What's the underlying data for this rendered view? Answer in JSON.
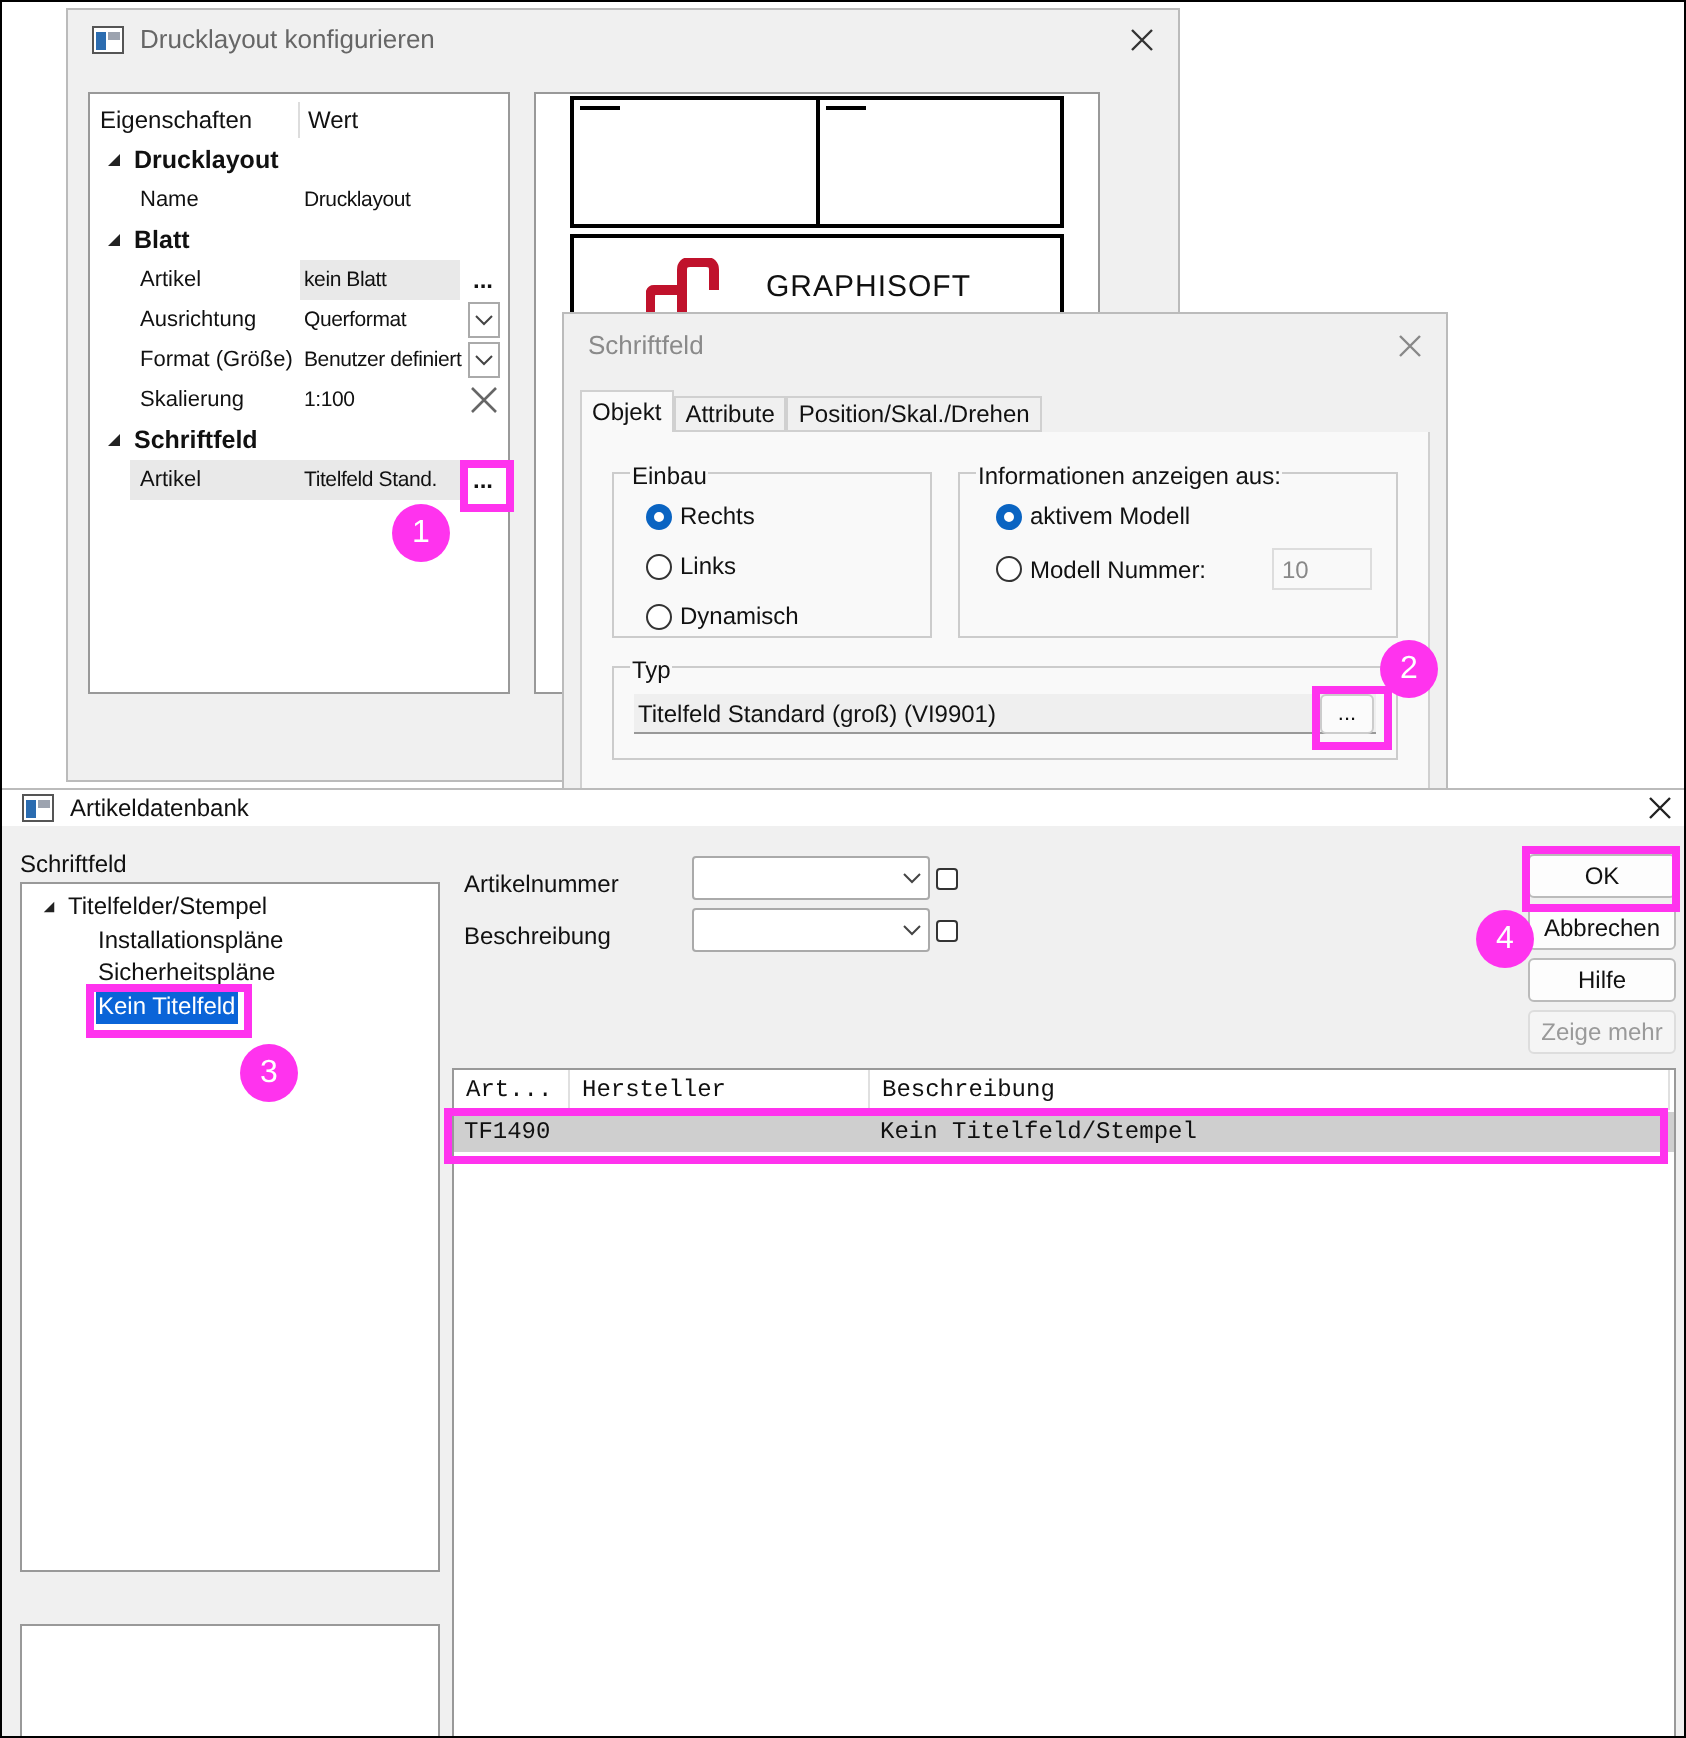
{
  "drucklayout": {
    "title": "Drucklayout konfigurieren",
    "columns": [
      "Eigenschaften",
      "Wert"
    ],
    "groups": [
      {
        "label": "Drucklayout",
        "expanded": true,
        "rows": [
          {
            "name": "Name",
            "value": "Drucklayout",
            "kind": "text",
            "selected": false
          }
        ]
      },
      {
        "label": "Blatt",
        "expanded": true,
        "rows": [
          {
            "name": "Artikel",
            "value": "kein Blatt",
            "kind": "ellipsis",
            "selected": false
          },
          {
            "name": "Ausrichtung",
            "value": "Querformat",
            "kind": "dropdown",
            "selected": false
          },
          {
            "name": "Format (Größe)",
            "value": "Benutzer definiert",
            "kind": "dropdown",
            "selected": false
          },
          {
            "name": "Skalierung",
            "value": "1:100",
            "kind": "clear",
            "selected": false
          }
        ]
      },
      {
        "label": "Schriftfeld",
        "expanded": true,
        "rows": [
          {
            "name": "Artikel",
            "value": "Titelfeld Stand.",
            "kind": "button",
            "selected": true
          }
        ]
      }
    ],
    "row_button": "...",
    "preview": {
      "logo_text": "GRAPHISOFT"
    }
  },
  "schriftfeld": {
    "title": "Schriftfeld",
    "tabs": [
      {
        "label": "Objekt",
        "selected": true
      },
      {
        "label": "Attribute",
        "selected": false
      },
      {
        "label": "Position/Skal./Drehen",
        "selected": false
      }
    ],
    "einbau": {
      "label": "Einbau",
      "options": [
        {
          "label": "Rechts",
          "selected": true
        },
        {
          "label": "Links",
          "selected": false
        },
        {
          "label": "Dynamisch",
          "selected": false
        }
      ]
    },
    "info": {
      "label": "Informationen anzeigen aus:",
      "options": [
        {
          "label": "aktivem Modell",
          "selected": true
        },
        {
          "label": "Modell Nummer:",
          "selected": false
        }
      ],
      "number_value": "10"
    },
    "typ": {
      "label": "Typ",
      "value": "Titelfeld Standard (groß) (VI9901)",
      "button": "..."
    }
  },
  "artikeldatenbank": {
    "title": "Artikeldatenbank",
    "tree_label": "Schriftfeld",
    "tree": [
      {
        "label": "Titelfelder/Stempel",
        "expanded": true,
        "selected": false,
        "children": [
          {
            "label": "Installationspläne",
            "selected": false
          },
          {
            "label": "Sicherheitspläne",
            "selected": false
          },
          {
            "label": "Kein Titelfeld",
            "selected": true
          }
        ]
      }
    ],
    "filters": [
      {
        "label": "Artikelnummer",
        "checked": false
      },
      {
        "label": "Beschreibung",
        "checked": false
      }
    ],
    "buttons": [
      {
        "label": "OK",
        "disabled": false
      },
      {
        "label": "Abbrechen",
        "disabled": false
      },
      {
        "label": "Hilfe",
        "disabled": false
      },
      {
        "label": "Zeige mehr",
        "disabled": true
      }
    ],
    "table": {
      "columns": [
        "Art...",
        "Hersteller",
        "Beschreibung"
      ],
      "rows": [
        {
          "cells": [
            "TF1490",
            "",
            "Kein Titelfeld/Stempel"
          ],
          "selected": true
        }
      ]
    }
  },
  "callouts": [
    {
      "label": "1"
    },
    {
      "label": "2"
    },
    {
      "label": "3"
    },
    {
      "label": "4"
    }
  ]
}
